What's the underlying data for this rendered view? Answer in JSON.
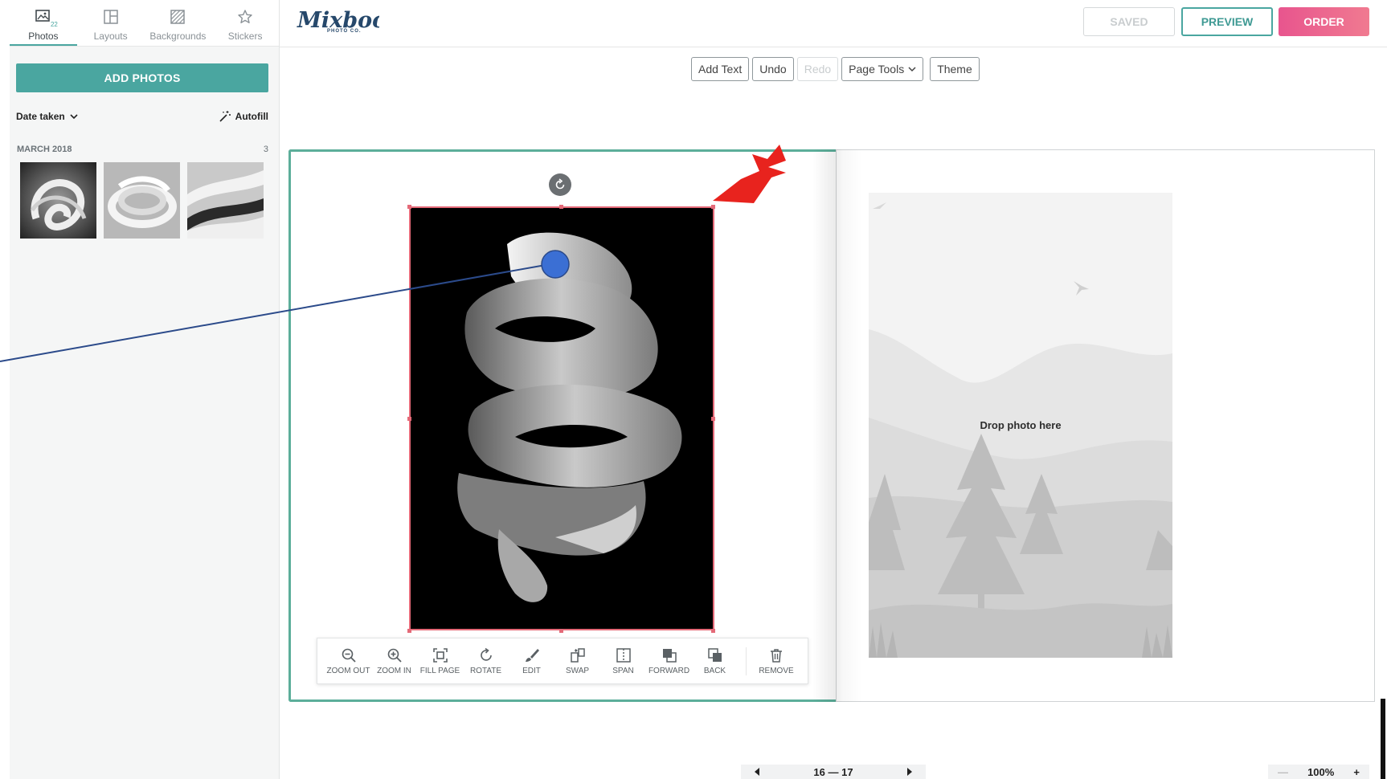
{
  "sidebar": {
    "tabs": [
      {
        "label": "Photos",
        "icon": "photos-icon",
        "badge": "22",
        "active": true
      },
      {
        "label": "Layouts",
        "icon": "layouts-icon"
      },
      {
        "label": "Backgrounds",
        "icon": "backgrounds-icon"
      },
      {
        "label": "Stickers",
        "icon": "star-icon"
      }
    ],
    "add_photos": "ADD PHOTOS",
    "sort_label": "Date taken",
    "autofill_label": "Autofill",
    "group": {
      "name": "MARCH 2018",
      "count": "3"
    }
  },
  "header": {
    "logo_text": "Mixbook",
    "logo_sub": "PHOTO CO.",
    "saved": "SAVED",
    "preview": "PREVIEW",
    "order": "ORDER"
  },
  "toolbar": {
    "add_text": "Add Text",
    "undo": "Undo",
    "redo": "Redo",
    "page_tools": "Page Tools",
    "theme": "Theme"
  },
  "canvas": {
    "drop_label": "Drop photo here"
  },
  "photo_tools": [
    {
      "label": "ZOOM OUT",
      "icon": "zoom-out-icon"
    },
    {
      "label": "ZOOM IN",
      "icon": "zoom-in-icon"
    },
    {
      "label": "FILL PAGE",
      "icon": "fill-page-icon"
    },
    {
      "label": "ROTATE",
      "icon": "rotate-icon"
    },
    {
      "label": "EDIT",
      "icon": "brush-icon"
    },
    {
      "label": "SWAP",
      "icon": "swap-icon"
    },
    {
      "label": "SPAN",
      "icon": "span-icon"
    },
    {
      "label": "FORWARD",
      "icon": "forward-icon"
    },
    {
      "label": "BACK",
      "icon": "back-icon"
    },
    {
      "label": "REMOVE",
      "icon": "trash-icon"
    }
  ],
  "pager": {
    "pages": "16 — 17"
  },
  "zoom": {
    "minus": "—",
    "value": "100%",
    "plus": "+"
  },
  "colors": {
    "accent": "#4aa6a0",
    "order": "#e8558e",
    "selection": "#e46a78",
    "annotation_arrow": "#e8231e",
    "click_marker": "#3b6fd4"
  }
}
